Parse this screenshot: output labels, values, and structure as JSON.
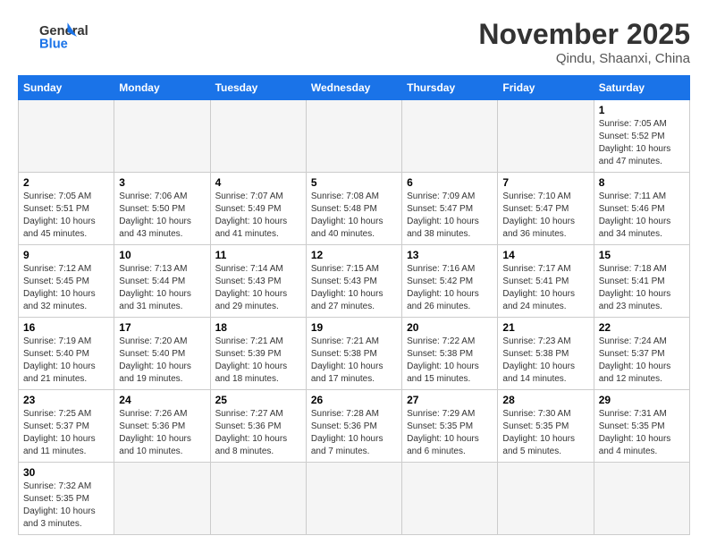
{
  "header": {
    "logo_general": "General",
    "logo_blue": "Blue",
    "title": "November 2025",
    "subtitle": "Qindu, Shaanxi, China"
  },
  "days_of_week": [
    "Sunday",
    "Monday",
    "Tuesday",
    "Wednesday",
    "Thursday",
    "Friday",
    "Saturday"
  ],
  "weeks": [
    [
      {
        "day": null,
        "info": null
      },
      {
        "day": null,
        "info": null
      },
      {
        "day": null,
        "info": null
      },
      {
        "day": null,
        "info": null
      },
      {
        "day": null,
        "info": null
      },
      {
        "day": null,
        "info": null
      },
      {
        "day": "1",
        "info": "Sunrise: 7:05 AM\nSunset: 5:52 PM\nDaylight: 10 hours and 47 minutes."
      }
    ],
    [
      {
        "day": "2",
        "info": "Sunrise: 7:05 AM\nSunset: 5:51 PM\nDaylight: 10 hours and 45 minutes."
      },
      {
        "day": "3",
        "info": "Sunrise: 7:06 AM\nSunset: 5:50 PM\nDaylight: 10 hours and 43 minutes."
      },
      {
        "day": "4",
        "info": "Sunrise: 7:07 AM\nSunset: 5:49 PM\nDaylight: 10 hours and 41 minutes."
      },
      {
        "day": "5",
        "info": "Sunrise: 7:08 AM\nSunset: 5:48 PM\nDaylight: 10 hours and 40 minutes."
      },
      {
        "day": "6",
        "info": "Sunrise: 7:09 AM\nSunset: 5:47 PM\nDaylight: 10 hours and 38 minutes."
      },
      {
        "day": "7",
        "info": "Sunrise: 7:10 AM\nSunset: 5:47 PM\nDaylight: 10 hours and 36 minutes."
      },
      {
        "day": "8",
        "info": "Sunrise: 7:11 AM\nSunset: 5:46 PM\nDaylight: 10 hours and 34 minutes."
      }
    ],
    [
      {
        "day": "9",
        "info": "Sunrise: 7:12 AM\nSunset: 5:45 PM\nDaylight: 10 hours and 32 minutes."
      },
      {
        "day": "10",
        "info": "Sunrise: 7:13 AM\nSunset: 5:44 PM\nDaylight: 10 hours and 31 minutes."
      },
      {
        "day": "11",
        "info": "Sunrise: 7:14 AM\nSunset: 5:43 PM\nDaylight: 10 hours and 29 minutes."
      },
      {
        "day": "12",
        "info": "Sunrise: 7:15 AM\nSunset: 5:43 PM\nDaylight: 10 hours and 27 minutes."
      },
      {
        "day": "13",
        "info": "Sunrise: 7:16 AM\nSunset: 5:42 PM\nDaylight: 10 hours and 26 minutes."
      },
      {
        "day": "14",
        "info": "Sunrise: 7:17 AM\nSunset: 5:41 PM\nDaylight: 10 hours and 24 minutes."
      },
      {
        "day": "15",
        "info": "Sunrise: 7:18 AM\nSunset: 5:41 PM\nDaylight: 10 hours and 23 minutes."
      }
    ],
    [
      {
        "day": "16",
        "info": "Sunrise: 7:19 AM\nSunset: 5:40 PM\nDaylight: 10 hours and 21 minutes."
      },
      {
        "day": "17",
        "info": "Sunrise: 7:20 AM\nSunset: 5:40 PM\nDaylight: 10 hours and 19 minutes."
      },
      {
        "day": "18",
        "info": "Sunrise: 7:21 AM\nSunset: 5:39 PM\nDaylight: 10 hours and 18 minutes."
      },
      {
        "day": "19",
        "info": "Sunrise: 7:21 AM\nSunset: 5:38 PM\nDaylight: 10 hours and 17 minutes."
      },
      {
        "day": "20",
        "info": "Sunrise: 7:22 AM\nSunset: 5:38 PM\nDaylight: 10 hours and 15 minutes."
      },
      {
        "day": "21",
        "info": "Sunrise: 7:23 AM\nSunset: 5:38 PM\nDaylight: 10 hours and 14 minutes."
      },
      {
        "day": "22",
        "info": "Sunrise: 7:24 AM\nSunset: 5:37 PM\nDaylight: 10 hours and 12 minutes."
      }
    ],
    [
      {
        "day": "23",
        "info": "Sunrise: 7:25 AM\nSunset: 5:37 PM\nDaylight: 10 hours and 11 minutes."
      },
      {
        "day": "24",
        "info": "Sunrise: 7:26 AM\nSunset: 5:36 PM\nDaylight: 10 hours and 10 minutes."
      },
      {
        "day": "25",
        "info": "Sunrise: 7:27 AM\nSunset: 5:36 PM\nDaylight: 10 hours and 8 minutes."
      },
      {
        "day": "26",
        "info": "Sunrise: 7:28 AM\nSunset: 5:36 PM\nDaylight: 10 hours and 7 minutes."
      },
      {
        "day": "27",
        "info": "Sunrise: 7:29 AM\nSunset: 5:35 PM\nDaylight: 10 hours and 6 minutes."
      },
      {
        "day": "28",
        "info": "Sunrise: 7:30 AM\nSunset: 5:35 PM\nDaylight: 10 hours and 5 minutes."
      },
      {
        "day": "29",
        "info": "Sunrise: 7:31 AM\nSunset: 5:35 PM\nDaylight: 10 hours and 4 minutes."
      }
    ],
    [
      {
        "day": "30",
        "info": "Sunrise: 7:32 AM\nSunset: 5:35 PM\nDaylight: 10 hours and 3 minutes."
      },
      {
        "day": null,
        "info": null
      },
      {
        "day": null,
        "info": null
      },
      {
        "day": null,
        "info": null
      },
      {
        "day": null,
        "info": null
      },
      {
        "day": null,
        "info": null
      },
      {
        "day": null,
        "info": null
      }
    ]
  ]
}
